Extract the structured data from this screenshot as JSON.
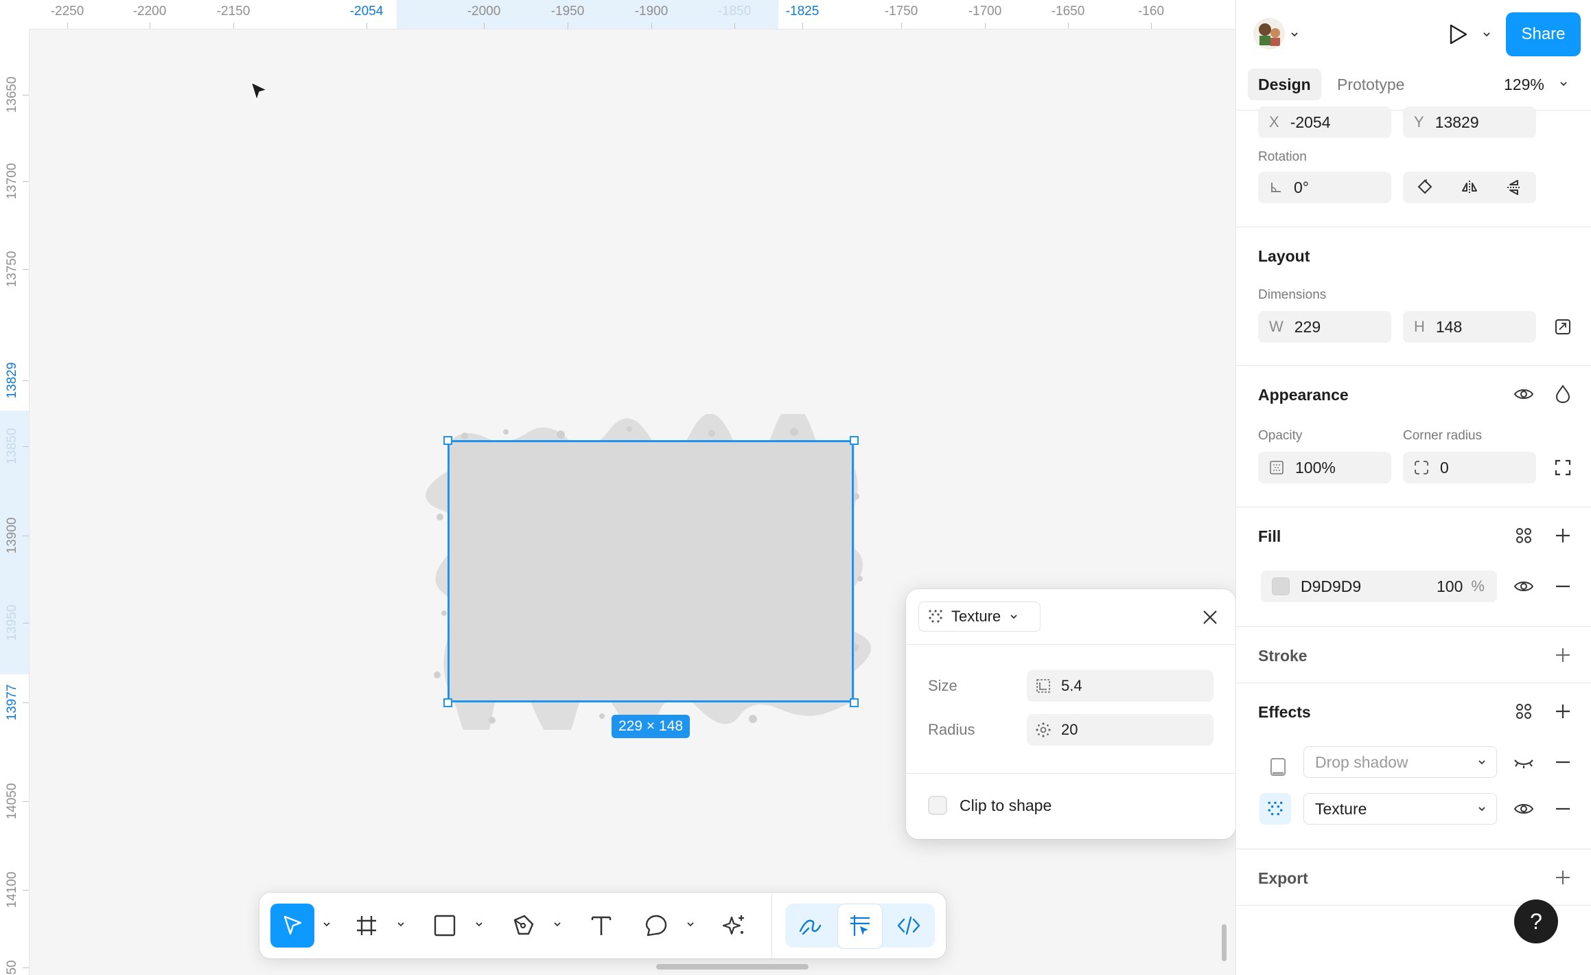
{
  "ruler": {
    "top_ticks": [
      "-2250",
      "-2200",
      "-2150",
      "-2054",
      "-2000",
      "-1950",
      "-1900",
      "-1850",
      "-1825",
      "-1750",
      "-1700",
      "-1650",
      "-160"
    ],
    "left_ticks": [
      "13650",
      "13700",
      "13750",
      "13829",
      "13850",
      "13900",
      "13950",
      "13977",
      "14050",
      "14100",
      "50"
    ]
  },
  "canvas": {
    "selection_size_label": "229 × 148"
  },
  "texture_popover": {
    "type_label": "Texture",
    "size_label": "Size",
    "size_value": "5.4",
    "radius_label": "Radius",
    "radius_value": "20",
    "clip_label": "Clip to shape",
    "clip_checked": false
  },
  "toolbar": {
    "tools": [
      "move-tool",
      "frame-tool",
      "rectangle-tool",
      "pen-tool",
      "text-tool",
      "comment-tool",
      "actions-tool"
    ],
    "modes": [
      "draw-mode",
      "design-mode",
      "dev-mode"
    ],
    "active_tool": "move-tool"
  },
  "panel": {
    "share_label": "Share",
    "tabs": {
      "design": "Design",
      "prototype": "Prototype"
    },
    "zoom": "129%",
    "position": {
      "x_label": "X",
      "x_value": "-2054",
      "y_label": "Y",
      "y_value": "13829"
    },
    "rotation": {
      "label": "Rotation",
      "value": "0°"
    },
    "layout": {
      "title": "Layout",
      "dimensions_label": "Dimensions",
      "w_label": "W",
      "w_value": "229",
      "h_label": "H",
      "h_value": "148"
    },
    "appearance": {
      "title": "Appearance",
      "opacity_label": "Opacity",
      "opacity_value": "100%",
      "corner_radius_label": "Corner radius",
      "corner_radius_value": "0"
    },
    "fill": {
      "title": "Fill",
      "hex": "D9D9D9",
      "swatch_color": "#d9d9d9",
      "opacity": "100",
      "percent": "%"
    },
    "stroke": {
      "title": "Stroke"
    },
    "effects": {
      "title": "Effects",
      "items": [
        {
          "label": "Drop shadow",
          "enabled": false
        },
        {
          "label": "Texture",
          "enabled": true
        }
      ]
    },
    "export": {
      "title": "Export"
    },
    "help_label": "?"
  },
  "colors": {
    "accent": "#0d99ff",
    "selection": "#1d95f0",
    "ruler_highlight": "#e5f1fb"
  }
}
